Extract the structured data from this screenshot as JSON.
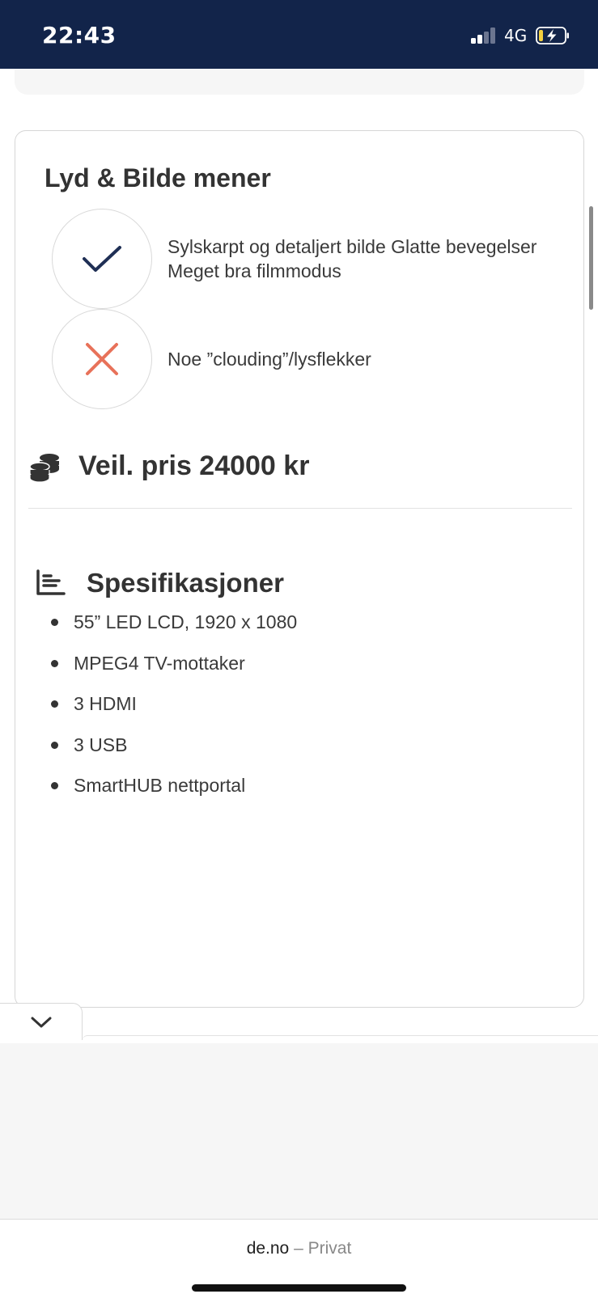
{
  "status_bar": {
    "time": "22:43",
    "network": "4G",
    "icons": [
      "signal-icon",
      "battery-charging-icon"
    ]
  },
  "review": {
    "title": "Lyd & Bilde mener",
    "positive": {
      "icon": "check-icon",
      "text": "Sylskarpt og detaljert bilde Glatte bevegelser Meget bra filmmodus"
    },
    "negative": {
      "icon": "cross-icon",
      "text": "Noe ”clouding”/lysflekker"
    }
  },
  "price": {
    "icon": "coins-icon",
    "label": "Veil. pris 24000 kr"
  },
  "specs": {
    "icon": "chart-bars-icon",
    "heading": "Spesifikasjoner",
    "items": [
      "55” LED LCD, 1920 x 1080",
      "MPEG4 TV-mottaker",
      "3 HDMI",
      "3 USB",
      "SmartHUB nettportal"
    ]
  },
  "collapse_button": {
    "icon": "chevron-down-icon"
  },
  "browser": {
    "url": "de.no",
    "separator": "–",
    "mode": "Privat"
  },
  "colors": {
    "status_bar_bg": "#12244a",
    "check_color": "#1f2f55",
    "cross_color": "#e8725a"
  }
}
